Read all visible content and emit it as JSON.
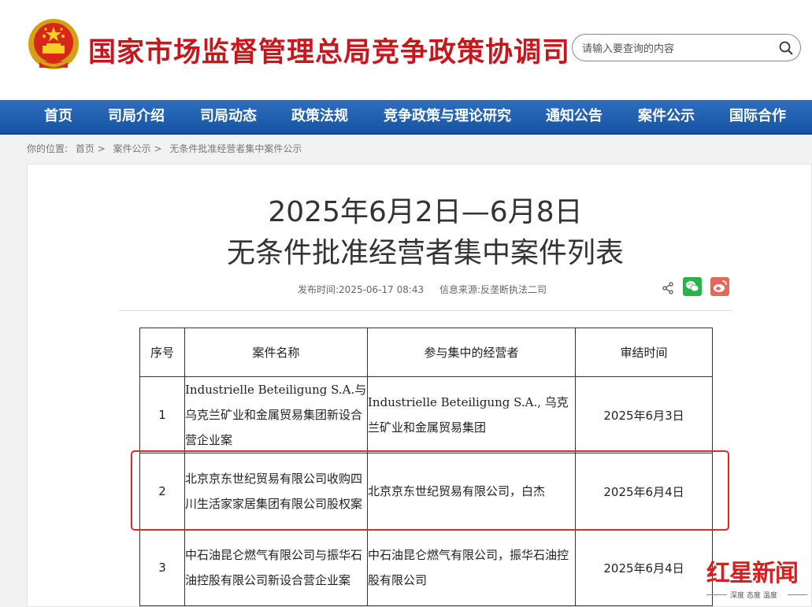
{
  "header": {
    "site_title": "国家市场监督管理总局竞争政策协调司",
    "search_placeholder": "请输入要查询的内容"
  },
  "nav": {
    "items": [
      "首页",
      "司局介绍",
      "司局动态",
      "政策法规",
      "竞争政策与理论研究",
      "通知公告",
      "案件公示",
      "国际合作"
    ]
  },
  "breadcrumb": {
    "label": "你的位置:",
    "items": [
      "首页",
      "案件公示",
      "无条件批准经营者集中案件公示"
    ],
    "separator": ">"
  },
  "article": {
    "title_line1": "2025年6月2日—6月8日",
    "title_line2": "无条件批准经营者集中案件列表",
    "published": "发布时间:2025-06-17 08:43",
    "source": "信息来源:反垄断执法二司"
  },
  "table": {
    "headers": [
      "序号",
      "案件名称",
      "参与集中的经营者",
      "审结时间"
    ],
    "rows": [
      {
        "no": "1",
        "name": "Industrielle Beteiligung S.A.与乌克兰矿业和金属贸易集团新设合营企业案",
        "parties": "Industrielle Beteiligung S.A., 乌克兰矿业和金属贸易集团",
        "date": "2025年6月3日"
      },
      {
        "no": "2",
        "name": "北京京东世纪贸易有限公司收购四川生活家家居集团有限公司股权案",
        "parties": "北京京东世纪贸易有限公司，白杰",
        "date": "2025年6月4日"
      },
      {
        "no": "3",
        "name": "中石油昆仑燃气有限公司与振华石油控股有限公司新设合营企业案",
        "parties": "中石油昆仑燃气有限公司，振华石油控股有限公司",
        "date": "2025年6月4日"
      }
    ]
  },
  "watermark": {
    "brand": "红星新闻",
    "tagline": "深度 态度 温度"
  },
  "colors": {
    "title_red": "#c8161d",
    "nav_blue": "#1653a3",
    "highlight_red": "#e0291e"
  }
}
